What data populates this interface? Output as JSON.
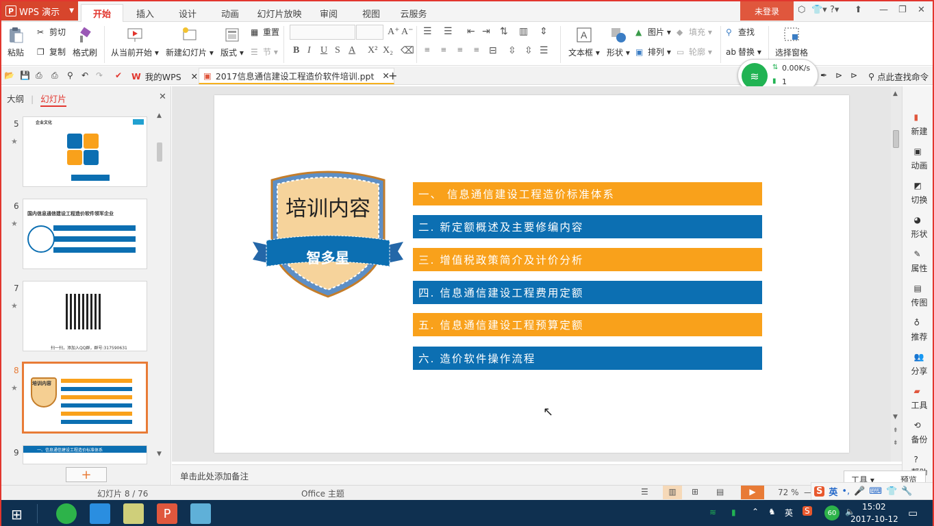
{
  "app": {
    "name": "WPS 演示",
    "login": "未登录"
  },
  "menu": [
    "开始",
    "插入",
    "设计",
    "动画",
    "幻灯片放映",
    "审阅",
    "视图",
    "云服务"
  ],
  "ribbon": {
    "paste": "粘贴",
    "cut": "剪切",
    "copy": "复制",
    "format_painter": "格式刷",
    "from_current": "从当前开始",
    "new_slide": "新建幻灯片",
    "layout": "版式",
    "reset": "重置",
    "section": "节",
    "textbox": "文本框",
    "shape": "形状",
    "picture": "图片",
    "fill": "填充",
    "arrange": "排列",
    "outline": "轮廓",
    "find": "查找",
    "replace": "替换",
    "select_pane": "选择窗格"
  },
  "quickbar": {
    "tab_wps": "我的WPS",
    "tab_doc": "2017信息通信建设工程造价软件培训.ppt",
    "search": "点此查找命令"
  },
  "network": {
    "speed": "0.00K/s",
    "count": "1"
  },
  "panel": {
    "tab_outline": "大纲",
    "tab_slides": "幻灯片"
  },
  "thumbnails": [
    {
      "num": "5",
      "title": "企业文化"
    },
    {
      "num": "6",
      "title": "国内信息通信建设工程造价软件领军企业"
    },
    {
      "num": "7",
      "title": "扫一扫，添加入QQ群，群号:317590631"
    },
    {
      "num": "8",
      "title": "培训内容"
    },
    {
      "num": "9",
      "title": "一、信息通信建设工程造价标准体系"
    }
  ],
  "slide": {
    "badge_title": "培训内容",
    "badge_ribbon": "智多星",
    "items": [
      {
        "text": "一、  信息通信建设工程造价标准体系",
        "color": "orange"
      },
      {
        "text": "二. 新定额概述及主要修编内容",
        "color": "blue"
      },
      {
        "text": "三. 增值税政策简介及计价分析",
        "color": "orange"
      },
      {
        "text": "四. 信息通信建设工程费用定额",
        "color": "blue"
      },
      {
        "text": "五. 信息通信建设工程预算定额",
        "color": "orange"
      },
      {
        "text": "六. 造价软件操作流程",
        "color": "blue"
      }
    ]
  },
  "righttoolbar": [
    "新建",
    "动画",
    "切换",
    "形状",
    "属性",
    "传图",
    "推荐",
    "分享",
    "工具",
    "备份",
    "帮助"
  ],
  "notes": "单击此处添加备注",
  "status": {
    "slide_count": "幻灯片 8 / 76",
    "theme": "Office 主题",
    "zoom": "72 %",
    "tools": "工具",
    "preview": "预览"
  },
  "taskbar": {
    "time": "15:02",
    "date": "2017-10-12",
    "ime": "英",
    "badge": "60"
  },
  "colors": {
    "accent": "#e2362e",
    "orange": "#f9a11b",
    "blue": "#0c6fb2",
    "taskbar": "#0f3050"
  }
}
